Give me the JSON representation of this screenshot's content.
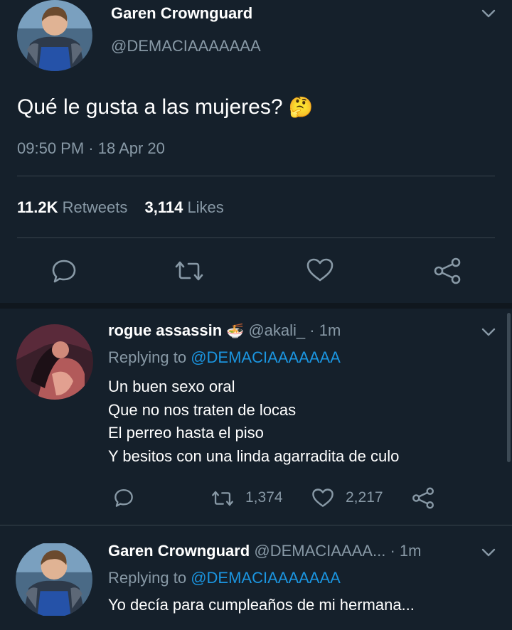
{
  "main_tweet": {
    "display_name": "Garen Crownguard",
    "handle": "@DEMACIAAAAAAA",
    "text": "Qué le gusta a las mujeres?",
    "emoji": "🤔",
    "timestamp": "09:50 PM · 18 Apr 20",
    "retweets_count": "11.2K",
    "retweets_label": "Retweets",
    "likes_count": "3,114",
    "likes_label": "Likes",
    "icons": [
      "reply-icon",
      "retweet-icon",
      "like-icon",
      "share-icon"
    ]
  },
  "replies": [
    {
      "display_name": "rogue assassin",
      "emoji": "🍜",
      "handle": "@akali_",
      "time": "· 1m",
      "replying_label": "Replying to",
      "replying_handle": "@DEMACIAAAAAAA",
      "lines": [
        "Un buen sexo oral",
        "Que no nos traten de locas",
        "El perreo hasta el piso",
        "Y besitos con una linda agarradita de culo"
      ],
      "retweets": "1,374",
      "likes": "2,217"
    },
    {
      "display_name": "Garen Crownguard",
      "handle": "@DEMACIAAAA...",
      "time": "· 1m",
      "replying_label": "Replying to",
      "replying_handle": "@DEMACIAAAAAAA",
      "lines": [
        "Yo decía para cumpleaños de mi hermana..."
      ]
    }
  ],
  "colors": {
    "background": "#15202b",
    "text": "#ffffff",
    "muted": "#8899a6",
    "link": "#1b95e0",
    "divider": "#38444d"
  }
}
